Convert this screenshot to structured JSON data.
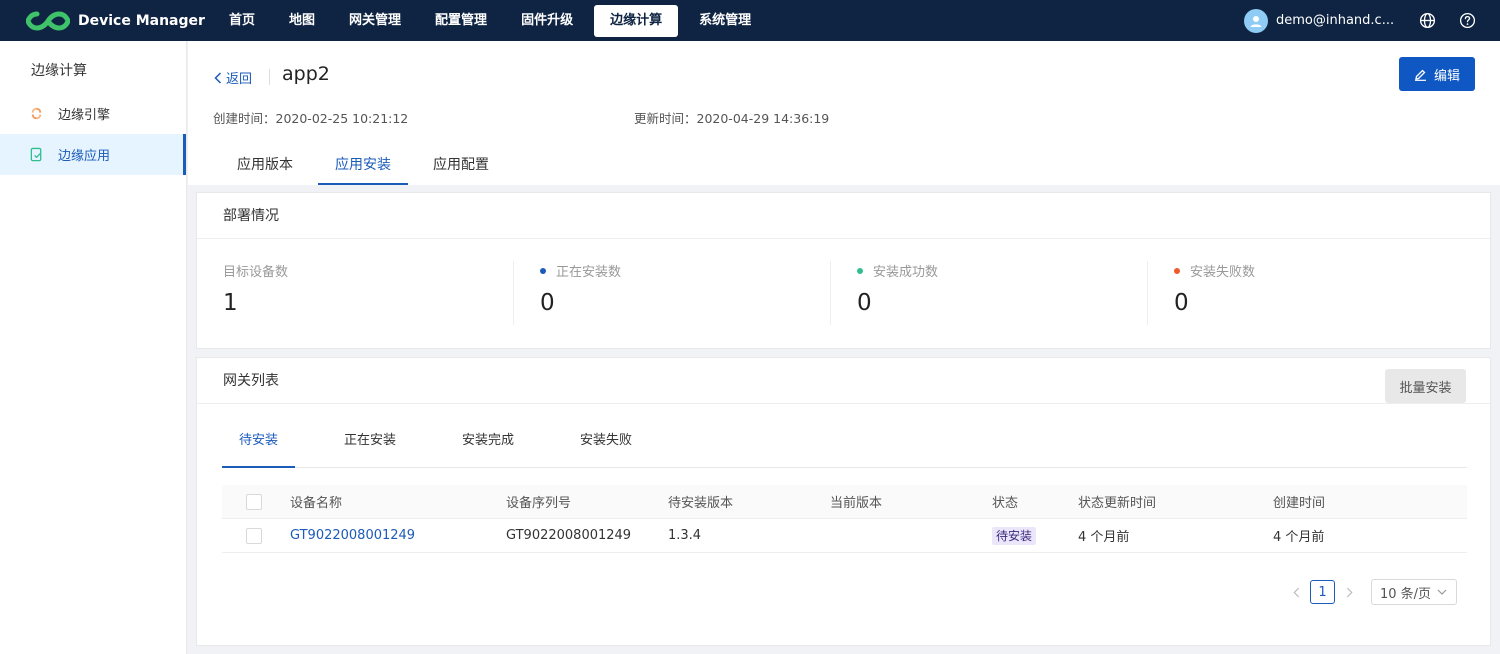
{
  "app": {
    "name": "Device Manager"
  },
  "nav": [
    {
      "label": "首页",
      "active": false
    },
    {
      "label": "地图",
      "active": false
    },
    {
      "label": "网关管理",
      "active": false
    },
    {
      "label": "配置管理",
      "active": false
    },
    {
      "label": "固件升级",
      "active": false
    },
    {
      "label": "边缘计算",
      "active": true
    },
    {
      "label": "系统管理",
      "active": false
    }
  ],
  "user": {
    "email": "demo@inhand.c..."
  },
  "sidebar": {
    "title": "边缘计算",
    "items": [
      {
        "label": "边缘引擎",
        "active": false
      },
      {
        "label": "边缘应用",
        "active": true
      }
    ]
  },
  "header": {
    "back_label": "返回",
    "title": "app2",
    "edit_label": "编辑",
    "created": "创建时间：2020-02-25 10:21:12",
    "updated": "更新时间：2020-04-29 14:36:19",
    "tabs": [
      {
        "label": "应用版本",
        "active": false
      },
      {
        "label": "应用安装",
        "active": true
      },
      {
        "label": "应用配置",
        "active": false
      }
    ]
  },
  "deploy": {
    "title": "部署情况",
    "stats": [
      {
        "label": "目标设备数",
        "value": "1",
        "dot": ""
      },
      {
        "label": "正在安装数",
        "value": "0",
        "dot": "#1b5bba"
      },
      {
        "label": "安装成功数",
        "value": "0",
        "dot": "#2fbf8f"
      },
      {
        "label": "安装失败数",
        "value": "0",
        "dot": "#f05a2b"
      }
    ]
  },
  "gateways": {
    "title": "网关列表",
    "batch_label": "批量安装",
    "subtabs": [
      {
        "label": "待安装",
        "active": true
      },
      {
        "label": "正在安装",
        "active": false
      },
      {
        "label": "安装完成",
        "active": false
      },
      {
        "label": "安装失败",
        "active": false
      }
    ],
    "columns": [
      "设备名称",
      "设备序列号",
      "待安装版本",
      "当前版本",
      "状态",
      "状态更新时间",
      "创建时间"
    ],
    "rows": [
      {
        "name": "GT9022008001249",
        "serial": "GT9022008001249",
        "pending_version": "1.3.4",
        "current_version": "",
        "status": "待安装",
        "status_updated": "4 个月前",
        "created": "4 个月前"
      }
    ],
    "pager": {
      "page": "1",
      "size": "10 条/页"
    }
  },
  "colors": {
    "topbar": "#0f2443",
    "accent": "#1b5bba",
    "primary_button": "#0f58c4"
  }
}
